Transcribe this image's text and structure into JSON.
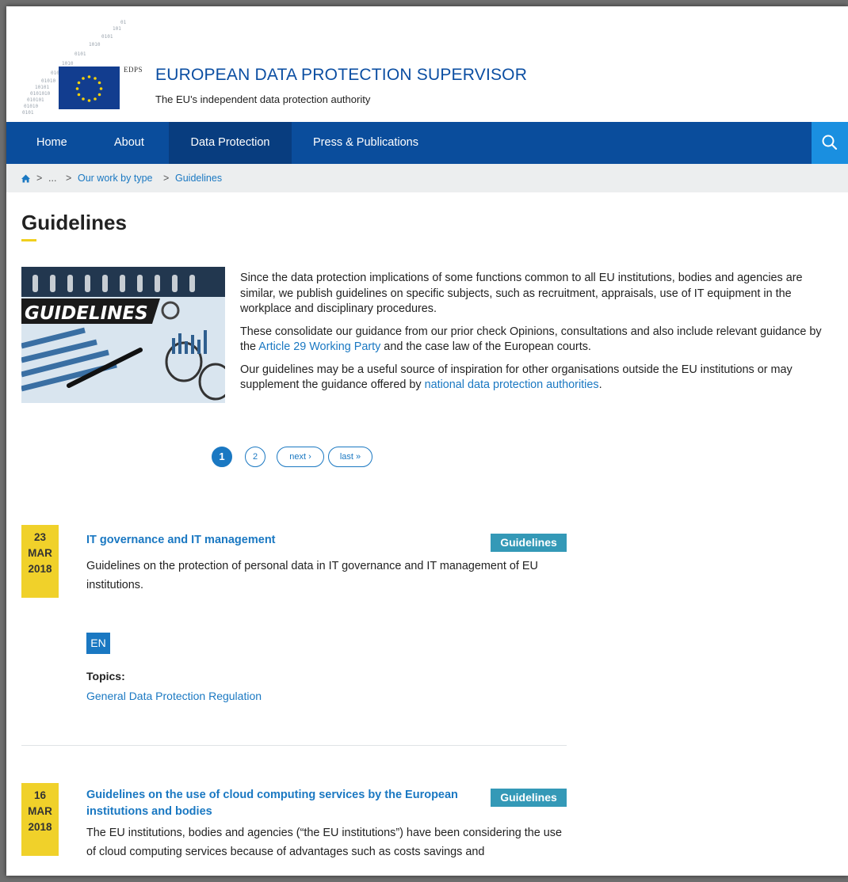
{
  "header": {
    "logo_text": "EDPS",
    "site_title": "EUROPEAN DATA PROTECTION SUPERVISOR",
    "site_subtitle": "The EU's independent data protection authority"
  },
  "nav": {
    "items": [
      {
        "label": "Home"
      },
      {
        "label": "About"
      },
      {
        "label": "Data Protection",
        "active": true
      },
      {
        "label": "Press & Publications"
      }
    ],
    "search_icon": "search-icon"
  },
  "breadcrumb": {
    "home_icon": "home-icon",
    "sep": ">",
    "ellipsis": "...",
    "our_work": "Our work by type",
    "current": "Guidelines"
  },
  "page": {
    "title": "Guidelines",
    "hero_label": "GUIDELINES"
  },
  "intro": {
    "p1": "Since the data protection implications of some functions common to all EU institutions, bodies and agencies are similar, we publish guidelines on specific subjects, such as recruitment, appraisals, use of IT equipment in the workplace and disciplinary procedures.",
    "p2_before": "These consolidate our guidance from our prior check Opinions, consultations and also include relevant guidance by the ",
    "p2_link": "Article 29 Working Party",
    "p2_after": " and the case law of the European courts.",
    "p3_before": "Our guidelines may be a useful source of inspiration for other organisations outside the EU institutions or may supplement the guidance offered by ",
    "p3_link": "national data protection authorities",
    "p3_after": "."
  },
  "pager": {
    "page1": "1",
    "page2": "2",
    "next": "next ›",
    "last": "last »"
  },
  "items": [
    {
      "day": "23",
      "month": "MAR",
      "year": "2018",
      "title": "IT governance and IT management",
      "tag": "Guidelines",
      "desc": "Guidelines on the protection of personal data in IT governance and IT management of EU institutions.",
      "lang": "EN",
      "topics_label": "Topics:",
      "topic": "General Data Protection Regulation"
    },
    {
      "day": "16",
      "month": "MAR",
      "year": "2018",
      "title": "Guidelines on the use of cloud computing services by the European institutions and bodies",
      "tag": "Guidelines",
      "desc": "The EU institutions, bodies and agencies (“the EU institutions”) have been considering the use of cloud computing services because of advantages such as costs savings and"
    }
  ]
}
